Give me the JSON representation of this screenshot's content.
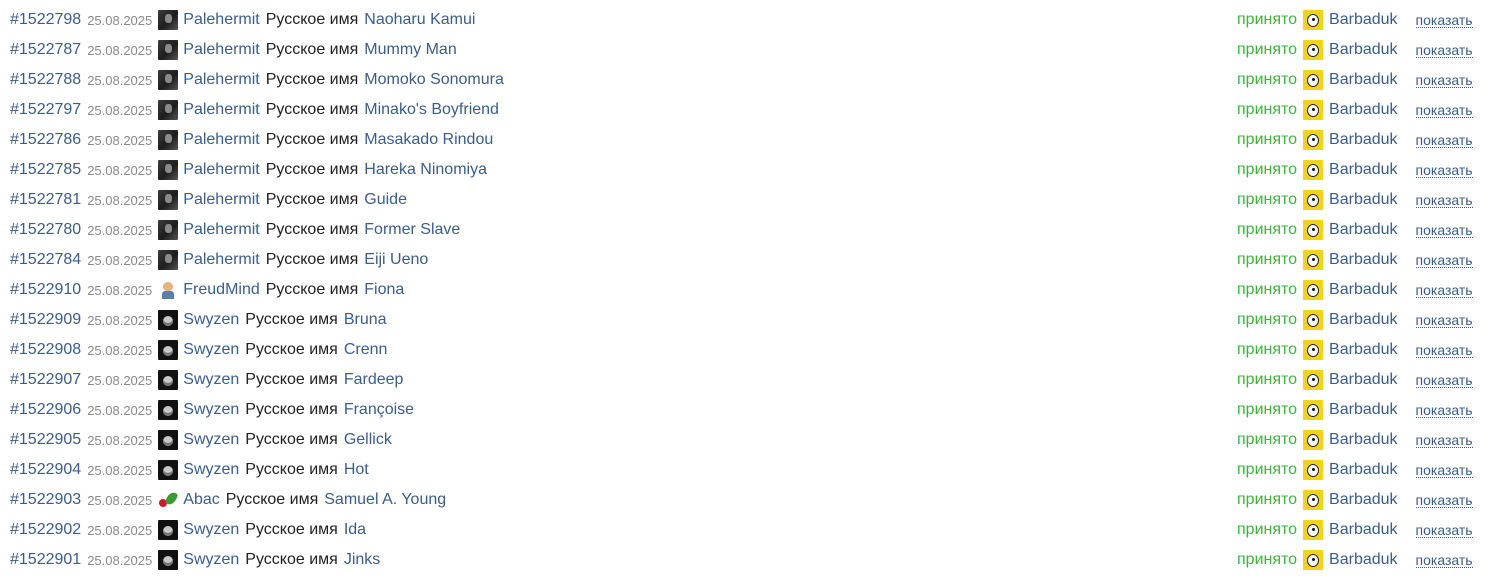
{
  "rows": [
    {
      "id": "#1522798",
      "date": "25.08.2025",
      "avatar": "palehermit-avatar",
      "user": "Palehermit",
      "label": "Русское имя",
      "target": "Naoharu Kamui",
      "status": "принято",
      "moderator": "Barbaduk",
      "action": "показать"
    },
    {
      "id": "#1522787",
      "date": "25.08.2025",
      "avatar": "palehermit-avatar",
      "user": "Palehermit",
      "label": "Русское имя",
      "target": "Mummy Man",
      "status": "принято",
      "moderator": "Barbaduk",
      "action": "показать"
    },
    {
      "id": "#1522788",
      "date": "25.08.2025",
      "avatar": "palehermit-avatar",
      "user": "Palehermit",
      "label": "Русское имя",
      "target": "Momoko Sonomura",
      "status": "принято",
      "moderator": "Barbaduk",
      "action": "показать"
    },
    {
      "id": "#1522797",
      "date": "25.08.2025",
      "avatar": "palehermit-avatar",
      "user": "Palehermit",
      "label": "Русское имя",
      "target": "Minako's Boyfriend",
      "status": "принято",
      "moderator": "Barbaduk",
      "action": "показать"
    },
    {
      "id": "#1522786",
      "date": "25.08.2025",
      "avatar": "palehermit-avatar",
      "user": "Palehermit",
      "label": "Русское имя",
      "target": "Masakado Rindou",
      "status": "принято",
      "moderator": "Barbaduk",
      "action": "показать"
    },
    {
      "id": "#1522785",
      "date": "25.08.2025",
      "avatar": "palehermit-avatar",
      "user": "Palehermit",
      "label": "Русское имя",
      "target": "Hareka Ninomiya",
      "status": "принято",
      "moderator": "Barbaduk",
      "action": "показать"
    },
    {
      "id": "#1522781",
      "date": "25.08.2025",
      "avatar": "palehermit-avatar",
      "user": "Palehermit",
      "label": "Русское имя",
      "target": "Guide",
      "status": "принято",
      "moderator": "Barbaduk",
      "action": "показать"
    },
    {
      "id": "#1522780",
      "date": "25.08.2025",
      "avatar": "palehermit-avatar",
      "user": "Palehermit",
      "label": "Русское имя",
      "target": "Former Slave",
      "status": "принято",
      "moderator": "Barbaduk",
      "action": "показать"
    },
    {
      "id": "#1522784",
      "date": "25.08.2025",
      "avatar": "palehermit-avatar",
      "user": "Palehermit",
      "label": "Русское имя",
      "target": "Eiji Ueno",
      "status": "принято",
      "moderator": "Barbaduk",
      "action": "показать"
    },
    {
      "id": "#1522910",
      "date": "25.08.2025",
      "avatar": "freudmind-avatar",
      "user": "FreudMind",
      "label": "Русское имя",
      "target": "Fiona",
      "status": "принято",
      "moderator": "Barbaduk",
      "action": "показать"
    },
    {
      "id": "#1522909",
      "date": "25.08.2025",
      "avatar": "swyzen-avatar",
      "user": "Swyzen",
      "label": "Русское имя",
      "target": "Bruna",
      "status": "принято",
      "moderator": "Barbaduk",
      "action": "показать"
    },
    {
      "id": "#1522908",
      "date": "25.08.2025",
      "avatar": "swyzen-avatar",
      "user": "Swyzen",
      "label": "Русское имя",
      "target": "Crenn",
      "status": "принято",
      "moderator": "Barbaduk",
      "action": "показать"
    },
    {
      "id": "#1522907",
      "date": "25.08.2025",
      "avatar": "swyzen-avatar",
      "user": "Swyzen",
      "label": "Русское имя",
      "target": "Fardeep",
      "status": "принято",
      "moderator": "Barbaduk",
      "action": "показать"
    },
    {
      "id": "#1522906",
      "date": "25.08.2025",
      "avatar": "swyzen-avatar",
      "user": "Swyzen",
      "label": "Русское имя",
      "target": "Françoise",
      "status": "принято",
      "moderator": "Barbaduk",
      "action": "показать"
    },
    {
      "id": "#1522905",
      "date": "25.08.2025",
      "avatar": "swyzen-avatar",
      "user": "Swyzen",
      "label": "Русское имя",
      "target": "Gellick",
      "status": "принято",
      "moderator": "Barbaduk",
      "action": "показать"
    },
    {
      "id": "#1522904",
      "date": "25.08.2025",
      "avatar": "swyzen-avatar",
      "user": "Swyzen",
      "label": "Русское имя",
      "target": "Hot",
      "status": "принято",
      "moderator": "Barbaduk",
      "action": "показать"
    },
    {
      "id": "#1522903",
      "date": "25.08.2025",
      "avatar": "abac-avatar",
      "user": "Abac",
      "label": "Русское имя",
      "target": "Samuel A. Young",
      "status": "принято",
      "moderator": "Barbaduk",
      "action": "показать"
    },
    {
      "id": "#1522902",
      "date": "25.08.2025",
      "avatar": "swyzen-avatar",
      "user": "Swyzen",
      "label": "Русское имя",
      "target": "Ida",
      "status": "принято",
      "moderator": "Barbaduk",
      "action": "показать"
    },
    {
      "id": "#1522901",
      "date": "25.08.2025",
      "avatar": "swyzen-avatar",
      "user": "Swyzen",
      "label": "Русское имя",
      "target": "Jinks",
      "status": "принято",
      "moderator": "Barbaduk",
      "action": "показать"
    }
  ],
  "colors": {
    "link": "#3a5d8a",
    "accepted": "#3cb53c",
    "date": "#8a8a8a",
    "text": "#222222"
  }
}
